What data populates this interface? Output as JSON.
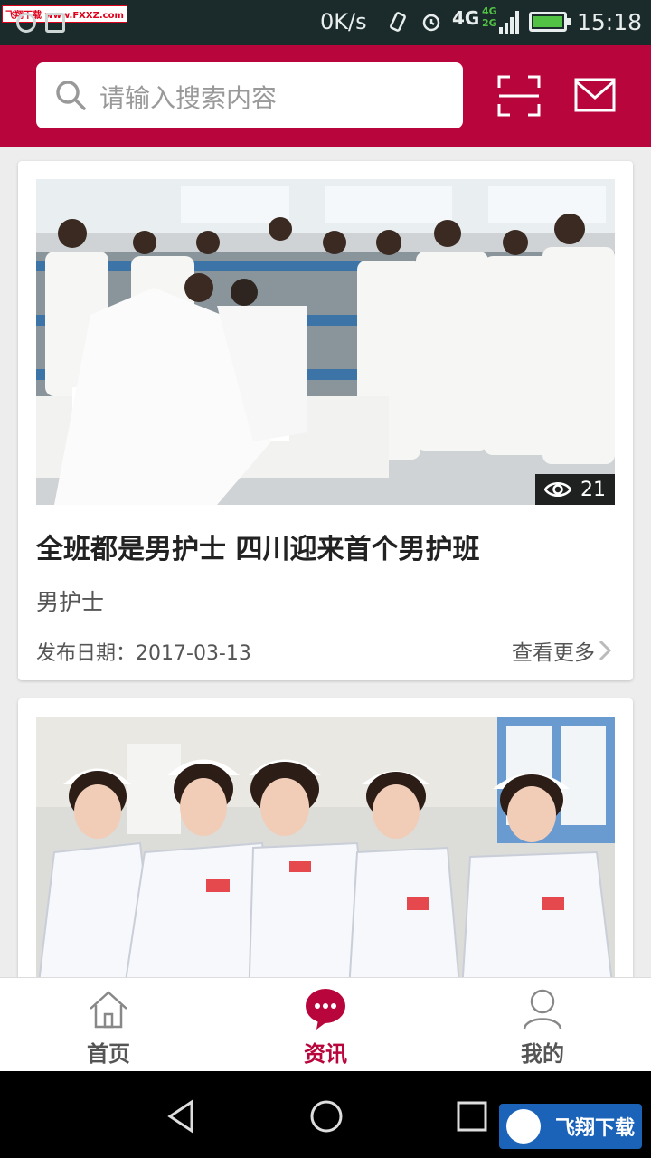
{
  "status_bar": {
    "watermark": "飞翔下载 www.FXXZ.com",
    "speed": "0K/s",
    "network": "4G",
    "network_small_top": "4G",
    "network_small_bottom": "2G",
    "time": "15:18",
    "icons": [
      "qq-icon",
      "image-icon",
      "vibrate-icon",
      "alarm-icon",
      "signal-icon",
      "battery-icon"
    ]
  },
  "header": {
    "search_placeholder": "请输入搜索内容",
    "accent_color": "#b8063d"
  },
  "feed": {
    "articles": [
      {
        "views": "21",
        "title": "全班都是男护士 四川迎来首个男护班",
        "tag": "男护士",
        "date_label": "发布日期：",
        "date": "2017-03-13",
        "more_label": "查看更多"
      },
      {
        "views": "",
        "title": "",
        "tag": "",
        "date_label": "",
        "date": "",
        "more_label": ""
      }
    ]
  },
  "tabbar": {
    "tabs": [
      {
        "label": "首页",
        "icon": "home-icon",
        "active": false
      },
      {
        "label": "资讯",
        "icon": "chat-bubble-icon",
        "active": true
      },
      {
        "label": "我的",
        "icon": "user-icon",
        "active": false
      }
    ]
  },
  "system_nav": {
    "logo_text": "飞翔下载"
  }
}
